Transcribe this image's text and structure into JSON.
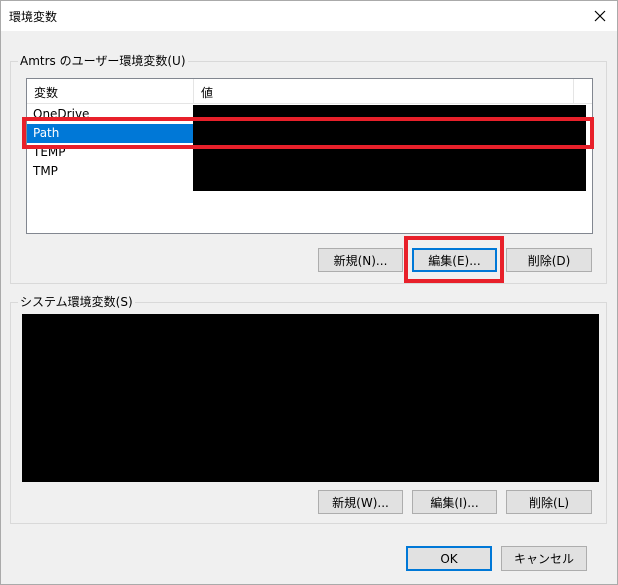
{
  "window": {
    "title": "環境変数",
    "close_glyph": "✕"
  },
  "user_vars": {
    "group_label": "Amtrs のユーザー環境変数(U)",
    "columns": [
      "変数",
      "値"
    ],
    "rows": [
      {
        "name": "OneDrive",
        "selected": false
      },
      {
        "name": "Path",
        "selected": true
      },
      {
        "name": "TEMP",
        "selected": false
      },
      {
        "name": "TMP",
        "selected": false
      }
    ],
    "buttons": {
      "new": "新規(N)...",
      "edit": "編集(E)...",
      "delete": "削除(D)"
    }
  },
  "system_vars": {
    "group_label": "システム環境変数(S)",
    "buttons": {
      "new": "新規(W)...",
      "edit": "編集(I)...",
      "delete": "削除(L)"
    }
  },
  "footer": {
    "ok": "OK",
    "cancel": "キャンセル"
  },
  "colors": {
    "selection": "#0078d7",
    "highlight": "#e8202a",
    "redaction": "#000000"
  }
}
